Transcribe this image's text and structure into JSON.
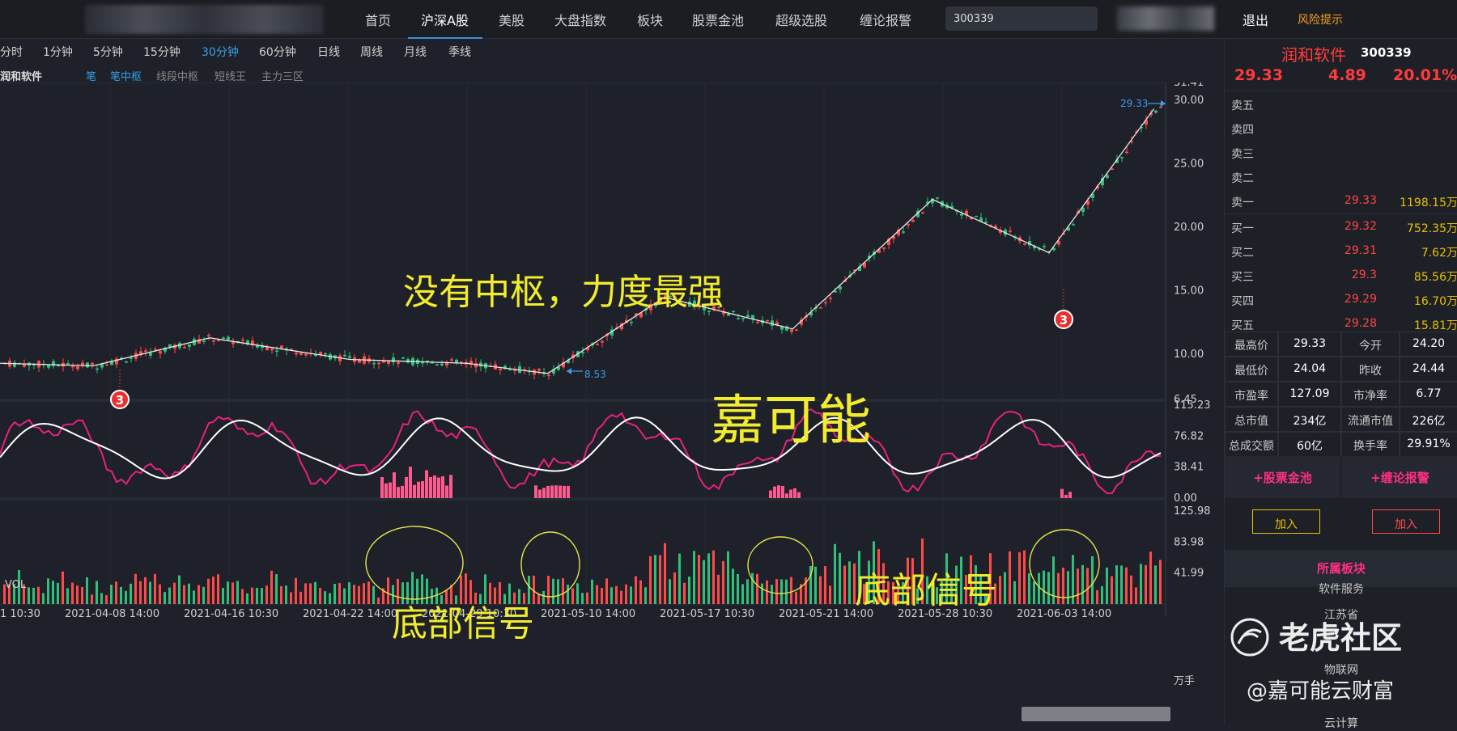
{
  "nav": {
    "items": [
      "首页",
      "沪深A股",
      "美股",
      "大盘指数",
      "板块",
      "股票金池",
      "超级选股",
      "缠论报警"
    ],
    "search_value": "300339",
    "exit": "退出",
    "risk": "风险提示"
  },
  "timeframes": [
    "分时",
    "1分钟",
    "5分钟",
    "15分钟",
    "30分钟",
    "60分钟",
    "日线",
    "周线",
    "月线",
    "季线"
  ],
  "active_timeframe": "30分钟",
  "indicators": {
    "stock_name": "润和软件",
    "items": [
      "笔",
      "笔中枢",
      "线段中枢",
      "短线王",
      "主力三区"
    ]
  },
  "chart_data": {
    "type": "line",
    "title": "润和软件 30分钟",
    "y_ticks": [
      "31.41",
      "30.00",
      "25.00",
      "20.00",
      "15.00",
      "10.00",
      "6.45"
    ],
    "ylim": [
      6.45,
      31.41
    ],
    "x_ticks": [
      "1 10:30",
      "2021-04-08 14:00",
      "2021-04-16 10:30",
      "2021-04-22 14:00",
      "2021-04-29 10:30",
      "2021-05-10 14:00",
      "2021-05-17 10:30",
      "2021-05-21 14:00",
      "2021-05-28 10:30",
      "2021-06-03 14:00"
    ],
    "bi_polyline": [
      [
        0,
        9.3
      ],
      [
        0.08,
        9.1
      ],
      [
        0.18,
        11.3
      ],
      [
        0.3,
        9.6
      ],
      [
        0.4,
        9.3
      ],
      [
        0.47,
        8.5
      ],
      [
        0.57,
        14.5
      ],
      [
        0.68,
        12.0
      ],
      [
        0.8,
        22.2
      ],
      [
        0.9,
        18.0
      ],
      [
        0.99,
        29.33
      ]
    ],
    "price_labels": [
      {
        "text": "29.33",
        "value": 29.33
      },
      {
        "text": "8.53",
        "value": 8.53
      }
    ],
    "signal_markers": [
      "3",
      "3"
    ],
    "osc_ticks": [
      "115.23",
      "76.82",
      "38.41",
      "0.00"
    ],
    "vol_label": "VOL",
    "vol_ticks": [
      "125.98",
      "83.98",
      "41.99"
    ],
    "vol_unit": "万手",
    "annotations": {
      "no_center": "没有中枢，力度最强",
      "brand": "嘉可能",
      "bottom_signal_1": "底部信号",
      "bottom_signal_2": "底部信号"
    }
  },
  "quote": {
    "name": "润和软件",
    "code": "300339",
    "price": "29.33",
    "change": "4.89",
    "pct": "20.01%",
    "order_book": [
      {
        "label": "卖五",
        "price": "",
        "vol": ""
      },
      {
        "label": "卖四",
        "price": "",
        "vol": ""
      },
      {
        "label": "卖三",
        "price": "",
        "vol": ""
      },
      {
        "label": "卖二",
        "price": "",
        "vol": ""
      },
      {
        "label": "卖一",
        "price": "29.33",
        "vol": "1198.15万"
      },
      {
        "label": "买一",
        "price": "29.32",
        "vol": "752.35万"
      },
      {
        "label": "买二",
        "price": "29.31",
        "vol": "7.62万"
      },
      {
        "label": "买三",
        "price": "29.3",
        "vol": "85.56万"
      },
      {
        "label": "买四",
        "price": "29.29",
        "vol": "16.70万"
      },
      {
        "label": "买五",
        "price": "29.28",
        "vol": "15.81万"
      }
    ],
    "stats": [
      [
        "最高价",
        "29.33",
        "今开",
        "24.20"
      ],
      [
        "最低价",
        "24.04",
        "昨收",
        "24.44"
      ],
      [
        "市盈率",
        "127.09",
        "市净率",
        "6.77"
      ],
      [
        "总市值",
        "234亿",
        "流通市值",
        "226亿"
      ],
      [
        "总成交额",
        "60亿",
        "换手率",
        "29.91%"
      ]
    ],
    "actions": [
      {
        "title": "+股票金池",
        "button": "加入",
        "color": "#e6c000"
      },
      {
        "title": "+缠论报警",
        "button": "加入",
        "color": "#ff4a4a"
      }
    ],
    "sector_header": "所属板块",
    "sectors": [
      "软件服务",
      "江苏省",
      "物联网",
      "云计算"
    ]
  },
  "watermark": {
    "main": "老虎社区",
    "sub": "@嘉可能云财富"
  }
}
